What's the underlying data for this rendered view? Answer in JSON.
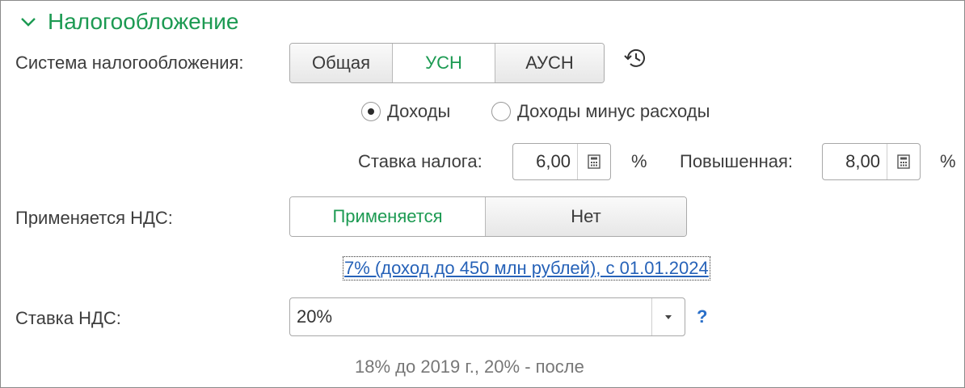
{
  "section": {
    "title": "Налогообложение",
    "icon": "chevron-down-icon"
  },
  "tax_system": {
    "label": "Система налогообложения:",
    "options": [
      "Общая",
      "УСН",
      "АУСН"
    ],
    "selected": "УСН",
    "history_icon": "history-icon"
  },
  "usn_object": {
    "options": [
      "Доходы",
      "Доходы минус расходы"
    ],
    "selected": "Доходы"
  },
  "tax_rate": {
    "label": "Ставка налога:",
    "value": "6,00",
    "unit": "%",
    "increased_label": "Повышенная:",
    "increased_value": "8,00",
    "increased_unit": "%",
    "calc_icon": "calculator-icon"
  },
  "vat": {
    "label": "Применяется НДС:",
    "options": [
      "Применяется",
      "Нет"
    ],
    "selected": "Применяется",
    "link": "7% (доход до 450 млн рублей), с 01.01.2024"
  },
  "vat_rate": {
    "label": "Ставка НДС:",
    "value": "20%",
    "help": "?",
    "note": "18% до 2019 г., 20% - после"
  },
  "colors": {
    "accent_green": "#1c9a52",
    "link_blue": "#2662b8",
    "help_blue": "#2a6fc9"
  }
}
